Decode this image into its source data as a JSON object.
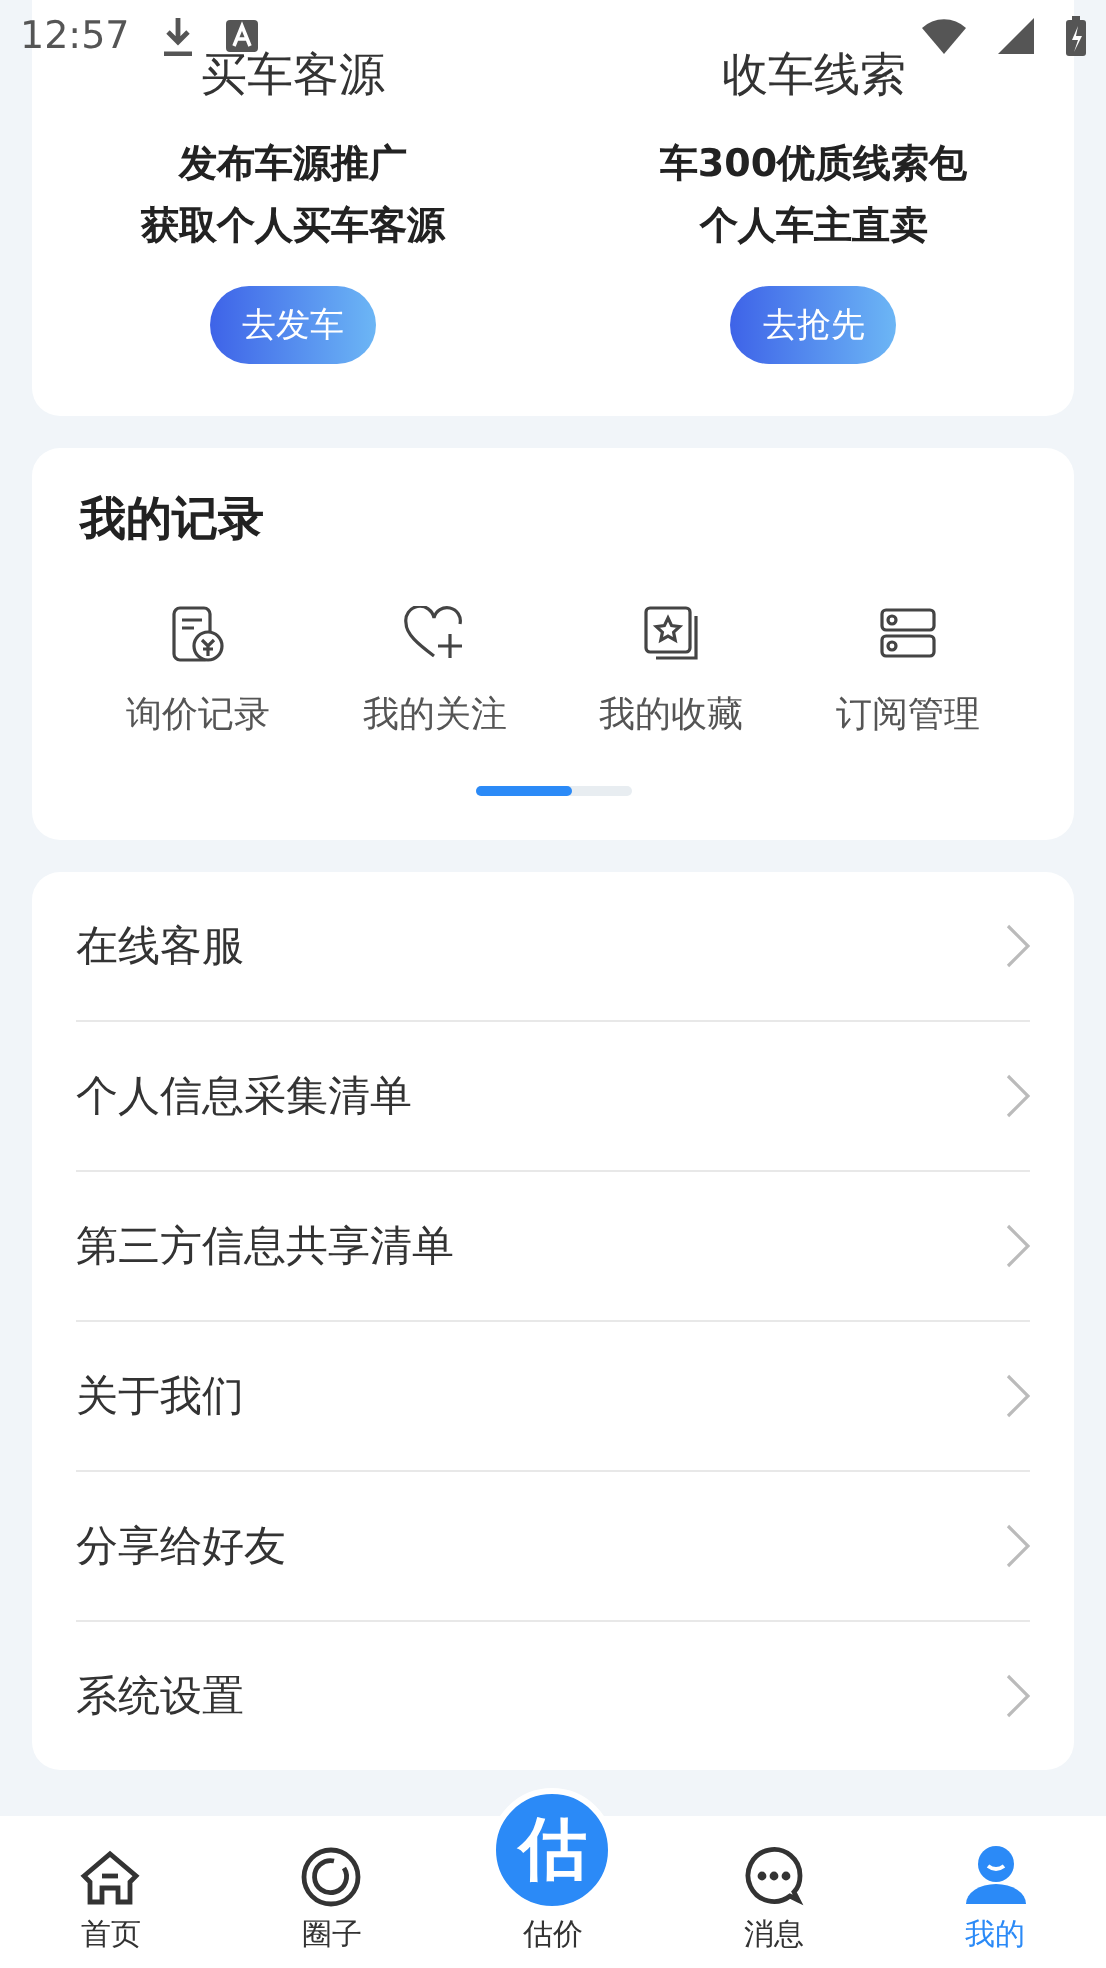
{
  "status_bar": {
    "time": "12:57"
  },
  "promo": [
    {
      "title": "买车客源",
      "lines": [
        "发布车源推广",
        "获取个人买车客源"
      ],
      "button": "去发车"
    },
    {
      "title": "收车线索",
      "lines": [
        "车300优质线索包",
        "个人车主直卖"
      ],
      "button": "去抢先"
    }
  ],
  "records": {
    "title": "我的记录",
    "items": [
      {
        "label": "询价记录"
      },
      {
        "label": "我的关注"
      },
      {
        "label": "我的收藏"
      },
      {
        "label": "订阅管理"
      }
    ]
  },
  "menu": [
    "在线客服",
    "个人信息采集清单",
    "第三方信息共享清单",
    "关于我们",
    "分享给好友",
    "系统设置"
  ],
  "tab_bar": [
    {
      "label": "首页",
      "selected": false
    },
    {
      "label": "圈子",
      "selected": false
    },
    {
      "label": "估价",
      "glyph": "估",
      "selected": false
    },
    {
      "label": "消息",
      "selected": false
    },
    {
      "label": "我的",
      "selected": true
    }
  ]
}
